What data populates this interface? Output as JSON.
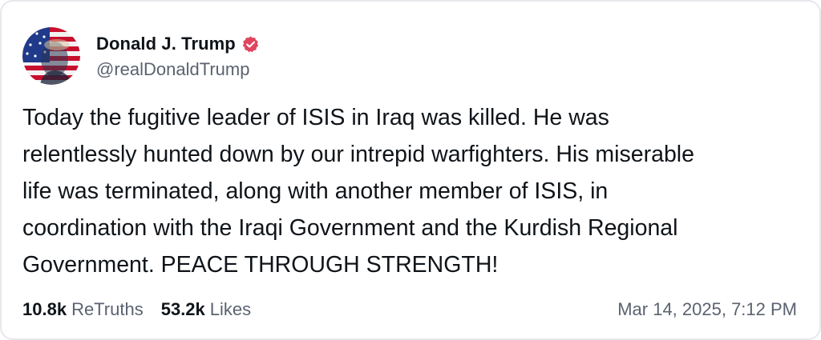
{
  "author": {
    "display_name": "Donald J. Trump",
    "handle": "@realDonaldTrump",
    "verified_icon": "verified-badge-icon",
    "verified_color": "#e0445f"
  },
  "post": {
    "text": "Today the fugitive leader of ISIS in Iraq was killed. He was\nrelentlessly hunted down by our intrepid warfighters. His miserable\nlife was terminated, along with another member of ISIS, in\ncoordination with the Iraqi Government and the Kurdish Regional\nGovernment. PEACE THROUGH STRENGTH!"
  },
  "stats": {
    "retruths_count": "10.8k",
    "retruths_label": "ReTruths",
    "likes_count": "53.2k",
    "likes_label": "Likes"
  },
  "timestamp": "Mar 14, 2025, 7:12 PM"
}
